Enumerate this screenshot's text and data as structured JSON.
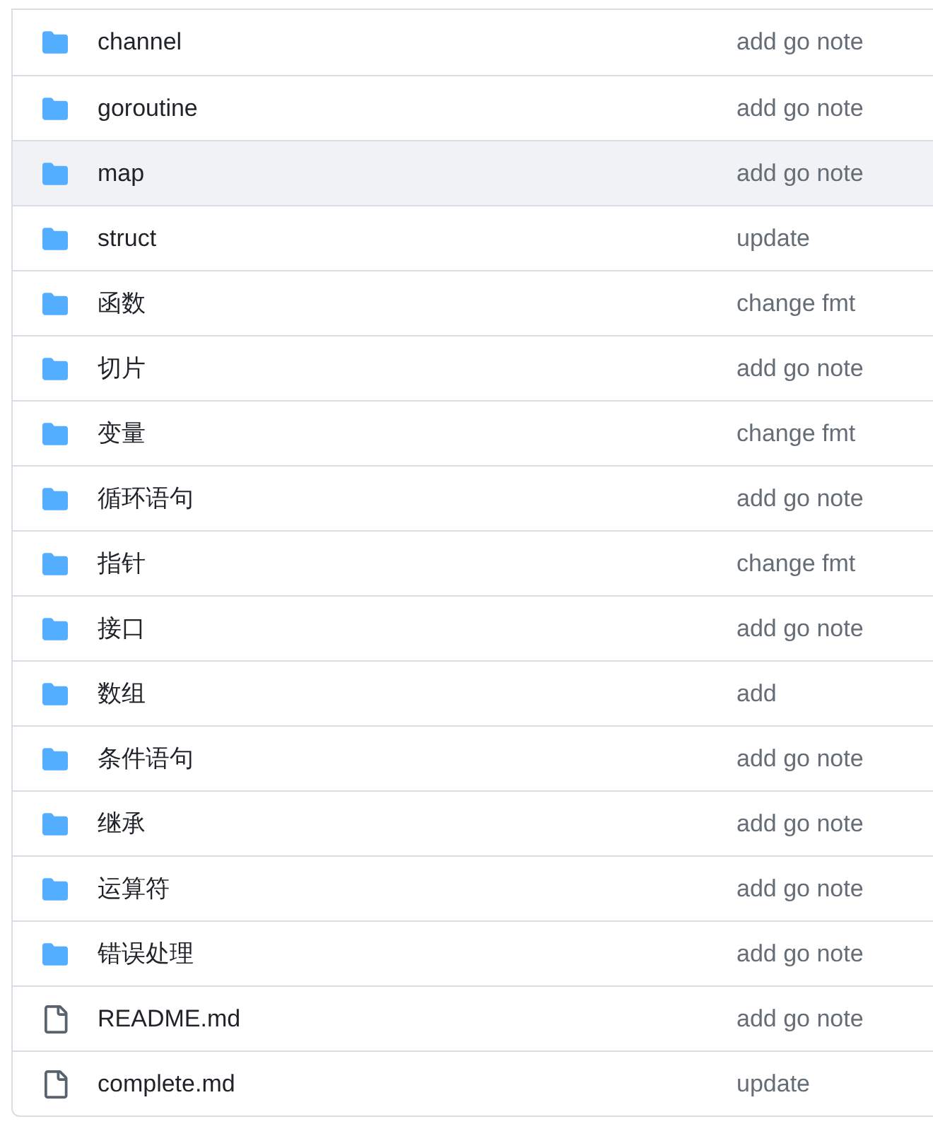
{
  "files": [
    {
      "kind": "folder",
      "name": "channel",
      "message": "add go note",
      "highlighted": false
    },
    {
      "kind": "folder",
      "name": "goroutine",
      "message": "add go note",
      "highlighted": false
    },
    {
      "kind": "folder",
      "name": "map",
      "message": "add go note",
      "highlighted": true
    },
    {
      "kind": "folder",
      "name": "struct",
      "message": "update",
      "highlighted": false
    },
    {
      "kind": "folder",
      "name": "函数",
      "message": "change fmt",
      "highlighted": false
    },
    {
      "kind": "folder",
      "name": "切片",
      "message": "add go note",
      "highlighted": false
    },
    {
      "kind": "folder",
      "name": "变量",
      "message": "change fmt",
      "highlighted": false
    },
    {
      "kind": "folder",
      "name": "循环语句",
      "message": "add go note",
      "highlighted": false
    },
    {
      "kind": "folder",
      "name": "指针",
      "message": "change fmt",
      "highlighted": false
    },
    {
      "kind": "folder",
      "name": "接口",
      "message": "add go note",
      "highlighted": false
    },
    {
      "kind": "folder",
      "name": "数组",
      "message": "add",
      "highlighted": false
    },
    {
      "kind": "folder",
      "name": "条件语句",
      "message": "add go note",
      "highlighted": false
    },
    {
      "kind": "folder",
      "name": "继承",
      "message": "add go note",
      "highlighted": false
    },
    {
      "kind": "folder",
      "name": "运算符",
      "message": "add go note",
      "highlighted": false
    },
    {
      "kind": "folder",
      "name": "错误处理",
      "message": "add go note",
      "highlighted": false
    },
    {
      "kind": "file",
      "name": "README.md",
      "message": "add go note",
      "highlighted": false
    },
    {
      "kind": "file",
      "name": "complete.md",
      "message": "update",
      "highlighted": false
    }
  ]
}
